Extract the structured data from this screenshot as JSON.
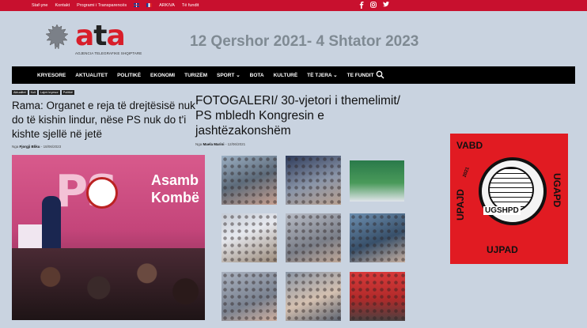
{
  "topbar": {
    "links": [
      "Staf-yne",
      "Kontakt",
      "Programi i Transparencës"
    ],
    "after_flags": [
      "ARKIVA",
      "Të fundit"
    ],
    "social_icons": [
      "facebook-icon",
      "instagram-icon",
      "twitter-icon"
    ]
  },
  "header": {
    "logo_text": "ata",
    "logo_subtitle": "AGJENCIA TELEGRAFIKE SHQIPTARE",
    "date_range": "12 Qershor 2021- 4 Shtator 2023"
  },
  "nav": {
    "items": [
      "KRYESORE",
      "AKTUALITET",
      "POLITIKË",
      "EKONOMI",
      "TURIZËM",
      "SPORT ⌄",
      "BOTA",
      "KULTURË",
      "TË TJERA ⌄",
      "TE FUNDIT"
    ]
  },
  "article_main": {
    "tags": [
      "Aktualitet",
      "Kult",
      "Lajmi kryesor",
      "Politikë"
    ],
    "title": "Rama: Organet e reja të drejtësisë nuk do të kishin lindur, nëse PS nuk do t'i kishte sjellë në jetë",
    "author_prefix": "Nga",
    "author": "Fjorgji Bliku",
    "date": "18/06/2023",
    "image_text": {
      "asamb": "Asamb",
      "kombe": "Kombë",
      "ps": "PS"
    }
  },
  "article_gallery": {
    "title": "FOTOGALERI/ 30-vjetori i themelimit/ PS mbledh Kongresin e jashtëzakonshëm",
    "author_prefix": "Nga",
    "author": "Maela Marini",
    "date": "12/06/2021",
    "thumbnail_count": 9
  },
  "ad": {
    "top": "VABD",
    "left": "UPAJD",
    "year": "2021",
    "center": "UGSHPD",
    "right": "UGAPD",
    "bottom": "UJPAD"
  }
}
